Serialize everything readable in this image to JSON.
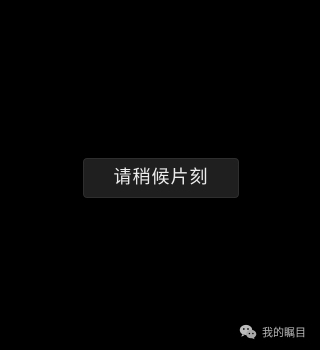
{
  "loading_toast": {
    "message": "请稍候片刻"
  },
  "watermark": {
    "icon": "wechat-icon",
    "text": "我的瞩目"
  },
  "colors": {
    "background": "#000000",
    "toast_background": "#1f1f1f",
    "toast_text": "#ececec",
    "watermark_text": "#dcdcdc"
  }
}
